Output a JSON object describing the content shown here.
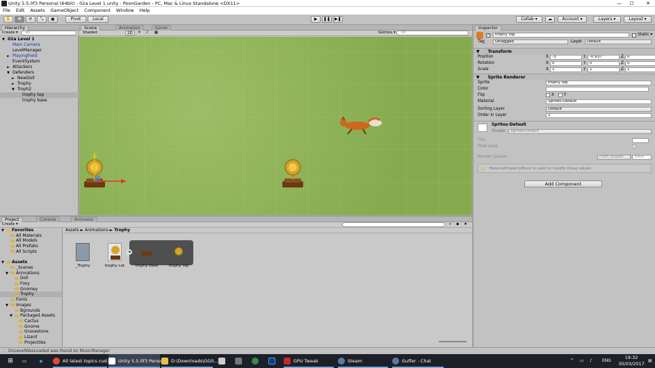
{
  "window": {
    "title": "Unity 5.5.0f3 Personal (64bit) - 02a Level 1.unity - PoonGarden - PC, Mac & Linux Standalone <DX11>",
    "minimize": "—",
    "maximize": "☐",
    "close": "✕"
  },
  "menu": [
    "File",
    "Edit",
    "Assets",
    "GameObject",
    "Component",
    "Window",
    "Help"
  ],
  "toolbar": {
    "pivot": "Pivot",
    "local": "Local",
    "collab": "Collab ▾",
    "account": "Account ▾",
    "layers": "Layers ▾",
    "layout": "Layout ▾"
  },
  "hierarchy": {
    "tab": "Hierarchy",
    "create": "Create ▾",
    "search": "All",
    "rows": [
      {
        "label": "02a Level 1",
        "indent": 0,
        "arrow": "▼",
        "bold": true
      },
      {
        "label": "Main Camera",
        "indent": 1,
        "arrow": "",
        "color": "#003ab3"
      },
      {
        "label": "LevelManager",
        "indent": 1,
        "arrow": ""
      },
      {
        "label": "PlayingField",
        "indent": 1,
        "arrow": "►",
        "color": "#003ab3"
      },
      {
        "label": "EventSystem",
        "indent": 1,
        "arrow": ""
      },
      {
        "label": "Attackers",
        "indent": 1,
        "arrow": "►"
      },
      {
        "label": "Defenders",
        "indent": 1,
        "arrow": "▼"
      },
      {
        "label": "NewDoll",
        "indent": 2,
        "arrow": "►"
      },
      {
        "label": "Trophy",
        "indent": 2,
        "arrow": "►"
      },
      {
        "label": "Troph2",
        "indent": 2,
        "arrow": "▼"
      },
      {
        "label": "trophy top",
        "indent": 3,
        "arrow": "",
        "selected": true
      },
      {
        "label": "trophy base",
        "indent": 3,
        "arrow": ""
      }
    ]
  },
  "scene": {
    "tabs": [
      "Scene",
      "Animation",
      "Game"
    ],
    "shaded": "Shaded",
    "mode2d": "2D",
    "gizmos": "Gizmos ▾",
    "search": "All"
  },
  "project": {
    "tabs": [
      "Project",
      "Console",
      "Animator"
    ],
    "create": "Create ▾",
    "breadcrumb": [
      "Assets",
      "Animations",
      "Trophy"
    ],
    "tree": [
      {
        "label": "Favorites",
        "indent": 0,
        "arrow": "▼",
        "bold": true,
        "star": true
      },
      {
        "label": "All Materials",
        "indent": 1,
        "arrow": ""
      },
      {
        "label": "All Models",
        "indent": 1,
        "arrow": ""
      },
      {
        "label": "All Prefabs",
        "indent": 1,
        "arrow": ""
      },
      {
        "label": "All Scripts",
        "indent": 1,
        "arrow": ""
      },
      {
        "label": "",
        "indent": 0,
        "arrow": ""
      },
      {
        "label": "Assets",
        "indent": 0,
        "arrow": "▼",
        "bold": true
      },
      {
        "label": "_Scenes",
        "indent": 1,
        "arrow": ""
      },
      {
        "label": "Animations",
        "indent": 1,
        "arrow": "▼"
      },
      {
        "label": "Doll",
        "indent": 2,
        "arrow": ""
      },
      {
        "label": "Foxy",
        "indent": 2,
        "arrow": ""
      },
      {
        "label": "Gnomey",
        "indent": 2,
        "arrow": ""
      },
      {
        "label": "Trophy",
        "indent": 2,
        "arrow": "",
        "selected": true
      },
      {
        "label": "Fonts",
        "indent": 1,
        "arrow": ""
      },
      {
        "label": "Images",
        "indent": 1,
        "arrow": "▼"
      },
      {
        "label": "Bgrounds",
        "indent": 2,
        "arrow": ""
      },
      {
        "label": "Packaged Assets",
        "indent": 2,
        "arrow": "▼"
      },
      {
        "label": "Cactus",
        "indent": 3,
        "arrow": ""
      },
      {
        "label": "Gnome",
        "indent": 3,
        "arrow": ""
      },
      {
        "label": "Gravestone",
        "indent": 3,
        "arrow": ""
      },
      {
        "label": "Lizard",
        "indent": 3,
        "arrow": ""
      },
      {
        "label": "Projectiles",
        "indent": 3,
        "arrow": ""
      }
    ],
    "assets": [
      "_Trophy",
      "trophy cut",
      "trophy base",
      "trophy top"
    ]
  },
  "inspector": {
    "tab": "Inspector",
    "name": "trophy top",
    "static": "Static ▾",
    "tag_label": "Tag",
    "tag": "Untagged",
    "layer_label": "Layer",
    "layer": "Default",
    "transform": {
      "title": "Transform",
      "position_label": "Position",
      "rotation_label": "Rotation",
      "scale_label": "Scale",
      "position": [
        "-3",
        "-0.937",
        "0"
      ],
      "rotation": [
        "0",
        "0",
        "0"
      ],
      "scale": [
        "1",
        "1",
        "1"
      ]
    },
    "sprite_renderer": {
      "title": "Sprite Renderer",
      "sprite_label": "Sprite",
      "sprite": "trophy top",
      "color_label": "Color",
      "flip_label": "Flip",
      "flip_x": "X",
      "flip_y": "Y",
      "material_label": "Material",
      "material": "Sprites-Default",
      "sorting_label": "Sorting Layer",
      "sorting": "Default",
      "order_label": "Order in Layer",
      "order": "2"
    },
    "material": {
      "name": "Sprites-Default",
      "shader_label": "Shader",
      "shader": "Sprites/Default",
      "tint_label": "Tint",
      "pixel_snap_label": "Pixel snap",
      "render_queue_label": "Render Queue",
      "render_queue_mode": "From Shader",
      "render_queue": "3000",
      "warning": "MaterialPropertyBlock is used to modify these values"
    },
    "add_component": "Add Component"
  },
  "status": "DnLevelWasLoaded was found on MusicManager",
  "taskbar": {
    "items": [
      "All latest topics cud...",
      "Unity 5.5.0f3 Perso...",
      "D:\\Downloads\\GG0...",
      "GPU Tweak",
      "Steam",
      "Guffer - Chat"
    ],
    "lang": "ENG",
    "time": "19:32",
    "date": "30/03/2017"
  },
  "colors": {
    "accent": "#3a72c9",
    "grass": "#8fb45a"
  }
}
